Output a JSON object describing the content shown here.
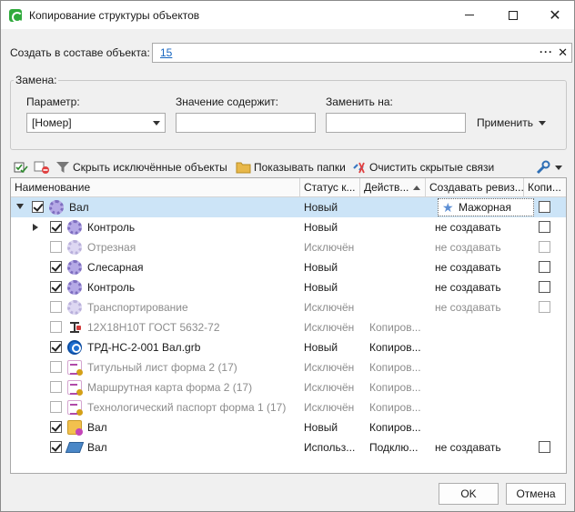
{
  "window": {
    "title": "Копирование структуры объектов",
    "minimize_icon": "minimize-icon",
    "maximize_icon": "maximize-icon",
    "close_icon": "close-icon"
  },
  "parent": {
    "label": "Создать в составе объекта:",
    "value": "15",
    "browse": "···",
    "clear": "✕"
  },
  "replace": {
    "legend": "Замена:",
    "param_label": "Параметр:",
    "param_value": "[Номер]",
    "contains_label": "Значение содержит:",
    "contains_value": "",
    "replace_label": "Заменить на:",
    "replace_value": "",
    "apply_label": "Применить"
  },
  "toolbar": {
    "hide_excluded": "Скрыть исключённые объекты",
    "show_folders": "Показывать папки",
    "clear_hidden_links": "Очистить скрытые связи"
  },
  "grid": {
    "columns": [
      "Наименование",
      "Статус к...",
      "Действ...",
      "Создавать ревиз...",
      "Копи..."
    ],
    "rows": [
      {
        "name": "Вал",
        "status": "Новый",
        "action": "",
        "revision": "Мажорная",
        "copy": false,
        "checked": true,
        "icon": "gear-icon"
      },
      {
        "name": "Контроль",
        "status": "Новый",
        "action": "",
        "revision": "не создавать",
        "copy": false,
        "checked": true,
        "icon": "gear-icon"
      },
      {
        "name": "Отрезная",
        "status": "Исключён",
        "action": "",
        "revision": "не создавать",
        "copy": false,
        "checked": false,
        "icon": "gear-icon"
      },
      {
        "name": "Слесарная",
        "status": "Новый",
        "action": "",
        "revision": "не создавать",
        "copy": false,
        "checked": true,
        "icon": "gear-icon"
      },
      {
        "name": "Контроль",
        "status": "Новый",
        "action": "",
        "revision": "не создавать",
        "copy": false,
        "checked": true,
        "icon": "gear-icon"
      },
      {
        "name": "Транспортирование",
        "status": "Исключён",
        "action": "",
        "revision": "не создавать",
        "copy": false,
        "checked": false,
        "icon": "gear-icon"
      },
      {
        "name": "12Х18Н10Т ГОСТ 5632-72",
        "status": "Исключён",
        "action": "Копиров...",
        "revision": "",
        "checked": false,
        "icon": "material-icon"
      },
      {
        "name": "ТРД-НС-2-001 Вал.grb",
        "status": "Новый",
        "action": "Копиров...",
        "revision": "",
        "checked": true,
        "icon": "cad-document-icon"
      },
      {
        "name": "Титульный лист форма 2 (17)",
        "status": "Исключён",
        "action": "Копиров...",
        "revision": "",
        "checked": false,
        "icon": "form-document-icon"
      },
      {
        "name": "Маршрутная карта форма 2 (17)",
        "status": "Исключён",
        "action": "Копиров...",
        "revision": "",
        "checked": false,
        "icon": "form-document-icon"
      },
      {
        "name": "Технологический паспорт форма 1 (17)",
        "status": "Исключён",
        "action": "Копиров...",
        "revision": "",
        "checked": false,
        "icon": "form-document-icon"
      },
      {
        "name": "Вал",
        "status": "Новый",
        "action": "Копиров...",
        "revision": "",
        "checked": true,
        "icon": "folder-document-icon"
      },
      {
        "name": "Вал",
        "status": "Использ...",
        "action": "Подклю...",
        "revision": "не создавать",
        "copy": false,
        "checked": true,
        "icon": "book-icon"
      }
    ]
  },
  "buttons": {
    "ok": "OK",
    "cancel": "Отмена"
  }
}
